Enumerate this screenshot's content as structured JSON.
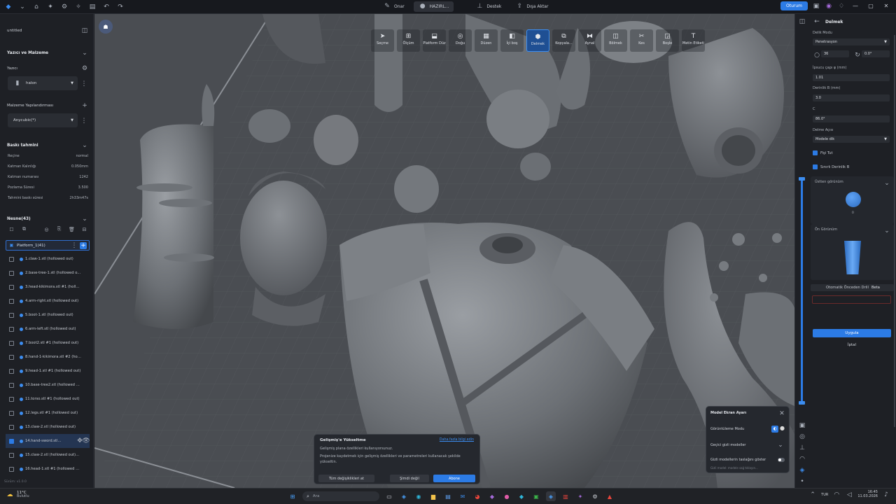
{
  "titlebar": {
    "tabs": [
      "Onar",
      "HAZIRL...",
      "Destek",
      "Dışa Aktar"
    ],
    "login_label": "Oturum"
  },
  "left_panel": {
    "project_name": "untitled",
    "printer_section_title": "Yazıcı ve Malzeme",
    "printer_label": "Yazıcı",
    "printer_value": "halon",
    "material_label": "Malzeme Yapılandırması",
    "material_value": "Anycubic(*)",
    "estimate_title": "Baskı tahmini",
    "estimates": [
      {
        "label": "Reçine",
        "value": "normal"
      },
      {
        "label": "Katman Kalınlığı",
        "value": "0.050mm"
      },
      {
        "label": "Katman numarası",
        "value": "1242"
      },
      {
        "label": "Pozlama Süresi",
        "value": "3.500"
      },
      {
        "label": "Tahmini baskı süresi",
        "value": "2h33m47s"
      }
    ],
    "objects_title": "Nesne(43)",
    "platform_label": "Platform_1(41)",
    "objects": [
      "1.claw-1.stl (hollowed out)",
      "2.base-tree-1.stl (hollowed o...",
      "3.head-kikimora.stl #1 (holl...",
      "4.arm-right.stl (hollowed out)",
      "5.boot-1.stl (hollowed out)",
      "6.arm-left.stl (hollowed out)",
      "7.boot2.stl #1 (hollowed out)",
      "8.hand-1-kikimora.stl #2 (hol...",
      "9.head-1.stl #1 (hollowed out)",
      "10.base-tree2.stl (hollowed o...",
      "11.torso.stl #1 (hollowed out)",
      "12.legs.stl #1 (hollowed out)",
      "13.claw-2.stl (hollowed out)",
      "14.hand-sword.stl...",
      "15.claw-2.stl (hollowed out)...",
      "16.head-1.stl #1 (hollowed o..."
    ],
    "selected_object_index": 13,
    "version_label": "Sürüm: v1.0.0"
  },
  "toolbar": {
    "tools": [
      "Seçme",
      "Ölçüm",
      "Platform Düz",
      "Doğu",
      "Düzen",
      "İçi boş",
      "Delmek",
      "Kopyala...",
      "Aynal",
      "Bölmek",
      "Kes",
      "Boşle",
      "Metin Etiketi"
    ],
    "active_tool": "Delmek"
  },
  "upgrade_popup": {
    "title": "Gelişmiş'e Yükseltme",
    "link": "Daha fazla bilgi edin",
    "line1": "Gelişmiş plana özellikleri kullanıyorsunuz.",
    "line2": "Projenize kaydetmek için gelişmiş özellikleri ve parametreleri kullanacak şekilde yükseltin.",
    "btn_discard": "Tüm değişiklikleri at",
    "btn_later": "Şimdi değil",
    "btn_subscribe": "Abone"
  },
  "display_popup": {
    "title": "Model Ekran Ayarı",
    "view_mode": "Görüntüleme Modu",
    "hide_models": "Geçici gizli modeller",
    "show_hidden": "Gizli modellerin taslağını göster",
    "note": "Gizli model: modele sağ tıklayın..."
  },
  "right_panel": {
    "title": "Delmek",
    "mode_label": "Delik Modu",
    "mode_value": "Penetrasyon",
    "count_value": "36",
    "angle_value": "0.0°",
    "diameter_label": "İpsucu çapı φ (mm)",
    "diameter_value": "1.01",
    "depth_label": "Derinlik B (mm)",
    "depth_value": "3.0",
    "c_label": "C",
    "c_value": "86.0°",
    "angle_label": "Delme Açısı",
    "angle_dd": "Modele dik",
    "chk1": "Fişi Tut",
    "chk2": "Sınırlı Derinlik B",
    "top_view": "Üstten görünüm",
    "top_value": "0",
    "front_view": "Ön Görünüm",
    "auto_drill": "Otomatik Önceden Drill",
    "beta": "Beta",
    "apply": "Uygula",
    "cancel": "İptal"
  },
  "taskbar": {
    "weather_temp": "11°C",
    "weather_desc": "Bulutlu",
    "search_placeholder": "Ara",
    "lang": "TUR",
    "time": "16:45",
    "date": "11.03.2026"
  }
}
